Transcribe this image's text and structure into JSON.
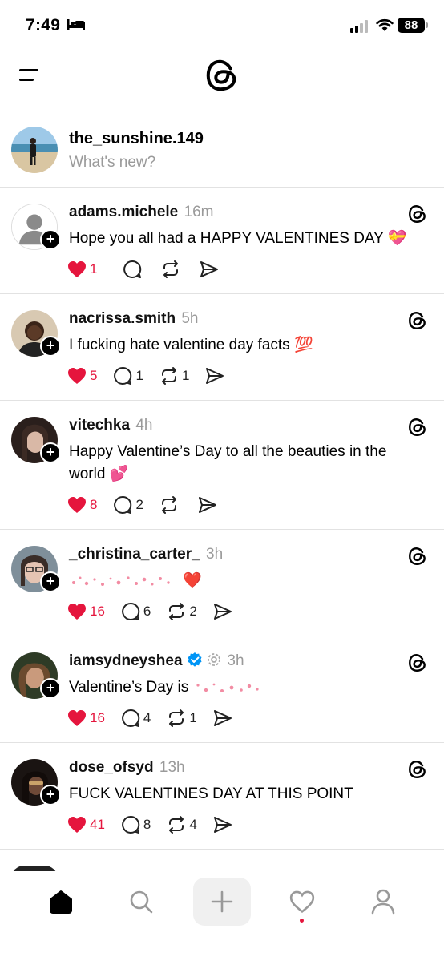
{
  "status_bar": {
    "time": "7:49",
    "battery": "88"
  },
  "composer": {
    "username": "the_sunshine.149",
    "placeholder": "What's new?"
  },
  "posts": [
    {
      "username": "adams.michele",
      "age": "16m",
      "text": "Hope you all had a HAPPY  VALENTINES  DAY",
      "emoji": "💝",
      "likes": "1",
      "replies": "",
      "reposts": ""
    },
    {
      "username": "nacrissa.smith",
      "age": "5h",
      "text": "I fucking hate valentine day facts",
      "emoji": "💯",
      "likes": "5",
      "replies": "1",
      "reposts": "1"
    },
    {
      "username": "vitechka",
      "age": "4h",
      "text": "Happy Valentine’s Day to all the beauties in the world",
      "emoji": "💕",
      "likes": "8",
      "replies": "2",
      "reposts": ""
    },
    {
      "username": "_christina_carter_",
      "age": "3h",
      "text": "",
      "emoji": "❤️",
      "likes": "16",
      "replies": "6",
      "reposts": "2"
    },
    {
      "username": "iamsydneyshea",
      "age": "3h",
      "text": "Valentine’s Day is",
      "emoji": "",
      "likes": "16",
      "replies": "4",
      "reposts": "1"
    },
    {
      "username": "dose_ofsyd",
      "age": "13h",
      "text": "FUCK VALENTINES DAY AT THIS POINT",
      "emoji": "",
      "likes": "41",
      "replies": "8",
      "reposts": "4"
    }
  ],
  "icons": {
    "menu": "menu-icon",
    "logo": "threads-logo-icon",
    "like": "heart-icon",
    "reply": "comment-icon",
    "repost": "repost-icon",
    "share": "send-icon",
    "verified": "verified-badge-icon",
    "home": "home-icon",
    "search": "search-icon",
    "create": "plus-icon",
    "activity": "heart-icon",
    "profile": "profile-icon"
  },
  "colors": {
    "like_red": "#e5153d",
    "muted": "#9a9a9a",
    "verified_blue": "#0095f6"
  }
}
